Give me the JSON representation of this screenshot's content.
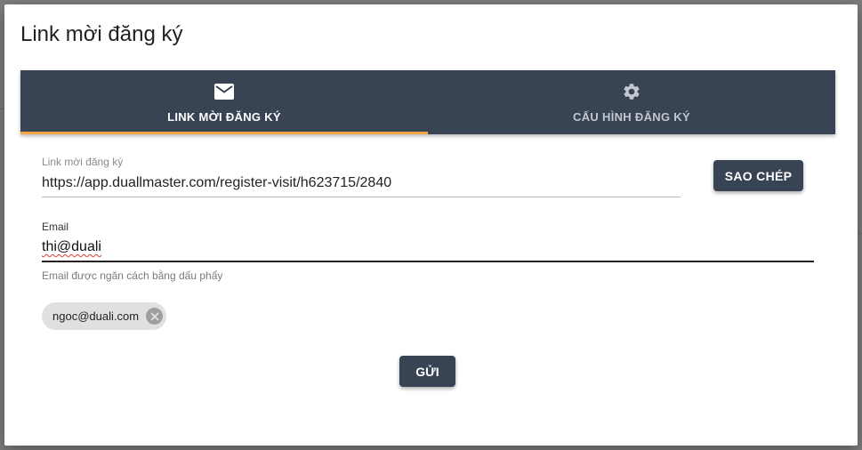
{
  "dialog": {
    "title": "Link mời đăng ký"
  },
  "tabs": [
    {
      "label": "LINK MỜI ĐĂNG KÝ",
      "icon": "mail-icon",
      "active": true
    },
    {
      "label": "CẤU HÌNH ĐĂNG KÝ",
      "icon": "gear-icon",
      "active": false
    }
  ],
  "invite_link": {
    "label": "Link mời đăng ký",
    "value": "https://app.duallmaster.com/register-visit/h623715/2840"
  },
  "copy_button": {
    "label": "SAO CHÉP"
  },
  "email": {
    "label": "Email",
    "value": "thi@duali",
    "hint": "Email được ngăn cách bằng dấu phẩy"
  },
  "chips": [
    {
      "text": "ngoc@duali.com"
    }
  ],
  "send_button": {
    "label": "GỬI"
  },
  "colors": {
    "primary": "#384454",
    "tab_indicator": "#f4a742",
    "chip_bg": "#e0e0e0"
  }
}
